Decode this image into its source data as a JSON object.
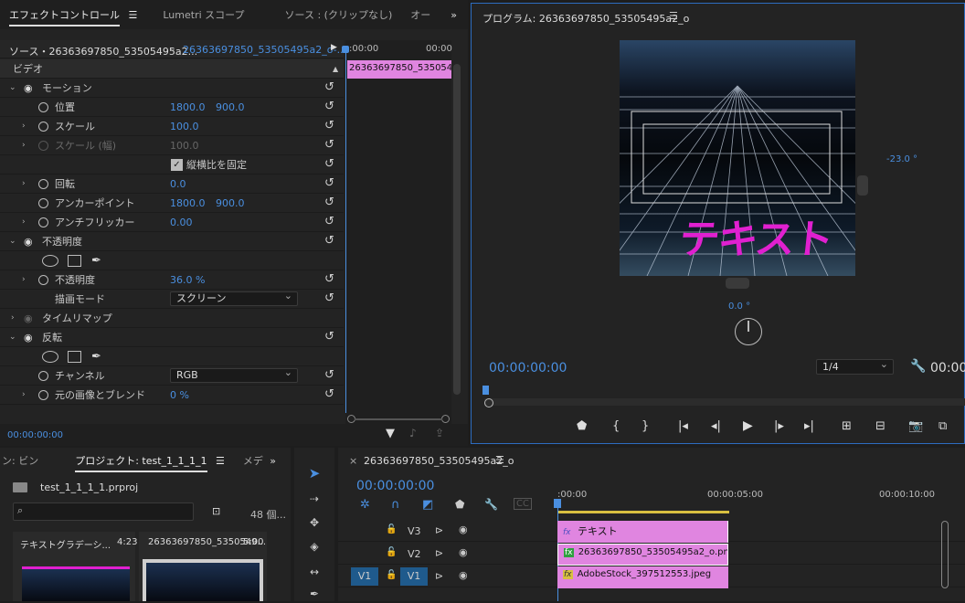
{
  "effect_panel": {
    "tabs": [
      "エフェクトコントロール",
      "Lumetri スコープ",
      "ソース : (クリップなし)",
      "オー"
    ],
    "menu_icon": "☰",
    "more_icon": "»",
    "source_label": "ソース・26363697850_53505495a2...",
    "sequence_label": "26363697850_53505495a2_o-...",
    "timecode_left": ":00:00",
    "timecode_right": "00:00",
    "clip_label": "26363697850_53505495",
    "section_video": "ビデオ",
    "motion": "モーション",
    "position": {
      "label": "位置",
      "x": "1800.0",
      "y": "900.0"
    },
    "scale": {
      "label": "スケール",
      "value": "100.0"
    },
    "scale_width": {
      "label": "スケール (幅)",
      "value": "100.0"
    },
    "uniform": "縦横比を固定",
    "rotation": {
      "label": "回転",
      "value": "0.0"
    },
    "anchor": {
      "label": "アンカーポイント",
      "x": "1800.0",
      "y": "900.0"
    },
    "flicker": {
      "label": "アンチフリッカー",
      "value": "0.00"
    },
    "opacity_group": "不透明度",
    "opacity": {
      "label": "不透明度",
      "value": "36.0 %"
    },
    "blend": {
      "label": "描画モード",
      "value": "スクリーン"
    },
    "timeremap": "タイムリマップ",
    "invert": "反転",
    "channel": {
      "label": "チャンネル",
      "value": "RGB"
    },
    "blend_original": {
      "label": "元の画像とブレンド",
      "value": "0 %"
    },
    "timecode_bottom": "00:00:00:00"
  },
  "program": {
    "title": "プログラム: 26363697850_53505495a2_o",
    "menu_icon": "☰",
    "overlay_text": "テキスト",
    "angle_right": "-23.0 °",
    "angle_bottom": "0.0 °",
    "timecode": "00:00:00:00",
    "zoom": "1/4",
    "timecode_right": "00:00"
  },
  "project": {
    "tabs": [
      "ン: ビン",
      "プロジェクト: test_1_1_1_1",
      "メデ"
    ],
    "menu_icon": "☰",
    "more_icon": "»",
    "file": "test_1_1_1_1.prproj",
    "search_placeholder": "",
    "count": "48 個...",
    "thumbs": [
      {
        "name": "テキストグラデーシ...",
        "dur": "4:23"
      },
      {
        "name": "26363697850_5350549...",
        "dur": "5:00"
      }
    ]
  },
  "timeline": {
    "title": "26363697850_53505495a2_o",
    "menu_icon": "☰",
    "timecode": "00:00:00:00",
    "ruler": [
      ":00:00",
      "00:00:05:00",
      "00:00:10:00"
    ],
    "tracks": [
      {
        "name": "V3",
        "src": "",
        "clip": "テキスト"
      },
      {
        "name": "V2",
        "src": "",
        "clip": "26363697850_53505495a2_o.png"
      },
      {
        "name": "V1",
        "src": "V1",
        "clip": "AdobeStock_397512553.jpeg"
      }
    ]
  },
  "colors": {
    "accent": "#4a8fe0",
    "clip": "#e085e0",
    "text_overlay": "#e020d0"
  }
}
